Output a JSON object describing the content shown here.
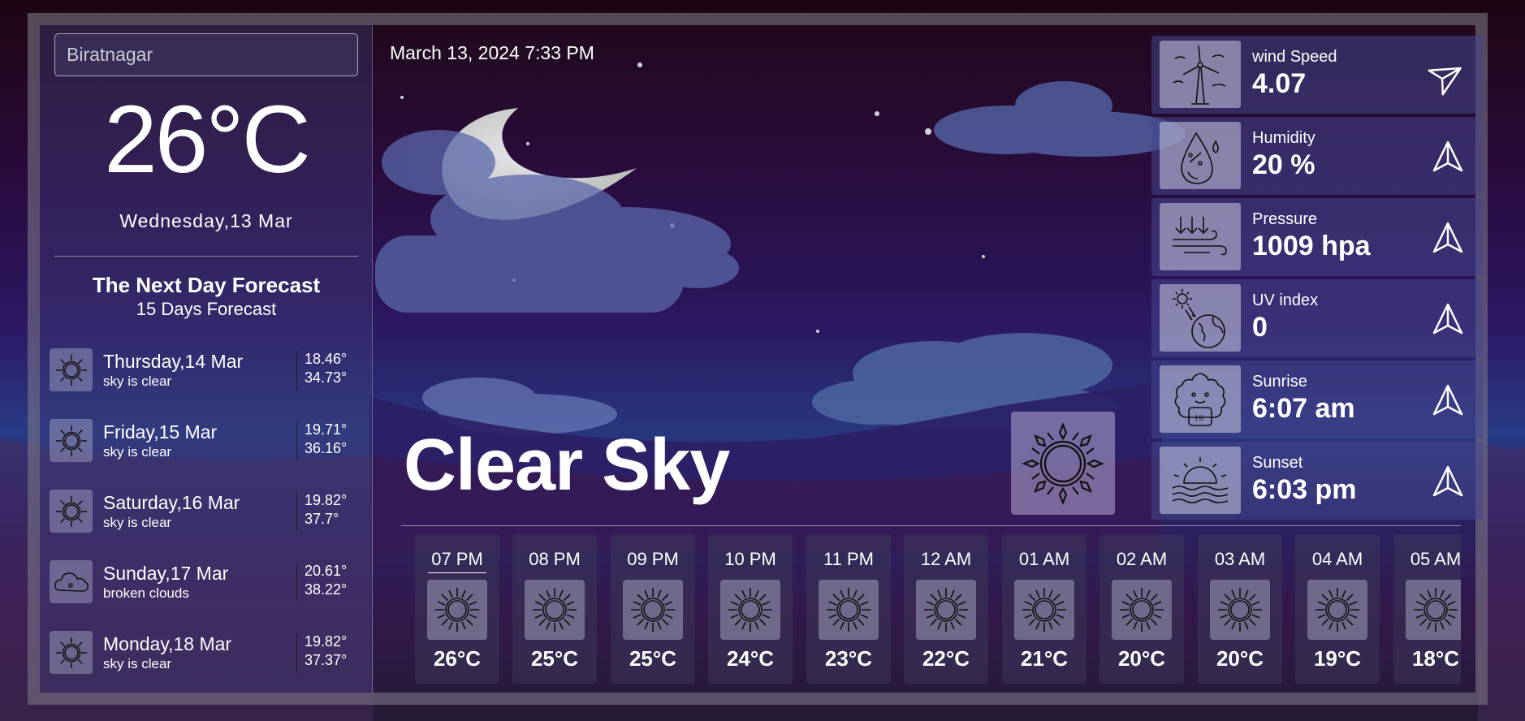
{
  "search": {
    "placeholder": "Biratnagar"
  },
  "current": {
    "temperature": "26°C",
    "date": "Wednesday,13 Mar",
    "datetime": "March 13, 2024 7:33 PM",
    "condition": "Clear Sky",
    "condition_icon": "sun-icon"
  },
  "forecast": {
    "title": "The Next Day Forecast",
    "subtitle": "15 Days Forecast",
    "days": [
      {
        "day": "Thursday,14 Mar",
        "desc": "sky is clear",
        "hi": "18.46°",
        "lo": "34.73°",
        "icon": "sun-icon"
      },
      {
        "day": "Friday,15 Mar",
        "desc": "sky is clear",
        "hi": "19.71°",
        "lo": "36.16°",
        "icon": "sun-icon"
      },
      {
        "day": "Saturday,16 Mar",
        "desc": "sky is clear",
        "hi": "19.82°",
        "lo": "37.7°",
        "icon": "sun-icon"
      },
      {
        "day": "Sunday,17 Mar",
        "desc": "broken clouds",
        "hi": "20.61°",
        "lo": "38.22°",
        "icon": "cloud-icon"
      },
      {
        "day": "Monday,18 Mar",
        "desc": "sky is clear",
        "hi": "19.82°",
        "lo": "37.37°",
        "icon": "sun-icon"
      }
    ]
  },
  "stats": [
    {
      "label": "wind Speed",
      "value": "4.07",
      "icon": "wind-turbine-icon"
    },
    {
      "label": "Humidity",
      "value": "20 %",
      "icon": "humidity-drop-icon"
    },
    {
      "label": "Pressure",
      "value": "1009 hpa",
      "icon": "pressure-icon"
    },
    {
      "label": "UV index",
      "value": "0",
      "icon": "uv-globe-icon"
    },
    {
      "label": "Sunrise",
      "value": "6:07 am",
      "icon": "sunrise-mascot-icon"
    },
    {
      "label": "Sunset",
      "value": "6:03 pm",
      "icon": "sunset-icon"
    }
  ],
  "hourly": [
    {
      "time": "07 PM",
      "temp": "26°C",
      "icon": "sun-icon",
      "selected": true
    },
    {
      "time": "08 PM",
      "temp": "25°C",
      "icon": "sun-icon"
    },
    {
      "time": "09 PM",
      "temp": "25°C",
      "icon": "sun-icon"
    },
    {
      "time": "10 PM",
      "temp": "24°C",
      "icon": "sun-icon"
    },
    {
      "time": "11 PM",
      "temp": "23°C",
      "icon": "sun-icon"
    },
    {
      "time": "12 AM",
      "temp": "22°C",
      "icon": "sun-icon"
    },
    {
      "time": "01 AM",
      "temp": "21°C",
      "icon": "sun-icon"
    },
    {
      "time": "02 AM",
      "temp": "20°C",
      "icon": "sun-icon"
    },
    {
      "time": "03 AM",
      "temp": "20°C",
      "icon": "sun-icon"
    },
    {
      "time": "04 AM",
      "temp": "19°C",
      "icon": "sun-icon"
    },
    {
      "time": "05 AM",
      "temp": "18°C",
      "icon": "sun-icon"
    }
  ]
}
